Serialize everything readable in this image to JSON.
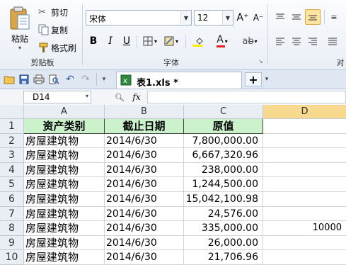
{
  "clipboard": {
    "paste_label": "粘贴",
    "cut_label": "剪切",
    "copy_label": "复制",
    "format_painter_label": "格式刷",
    "group_label": "剪贴板"
  },
  "font": {
    "name": "宋体",
    "size": "12",
    "bold": "B",
    "italic": "I",
    "underline": "U",
    "grow": "A⁺",
    "shrink": "A⁻",
    "group_label": "字体",
    "font_color": "#e02020",
    "highlight_color": "#ffee00"
  },
  "align": {
    "group_label_partial": "对"
  },
  "tabbar": {
    "file_tab": "表1.xls *",
    "add_tab": "+"
  },
  "formula_bar": {
    "name_box": "D14",
    "fx": "fx"
  },
  "sheet": {
    "columns": [
      "A",
      "B",
      "C",
      "D"
    ],
    "selected_column": "D",
    "header_row": [
      "资产类别",
      "截止日期",
      "原值"
    ],
    "header_fill": "#ccf2cc",
    "rows": [
      {
        "num": "1",
        "a": "资产类别",
        "b": "截止日期",
        "c": "原值",
        "d": ""
      },
      {
        "num": "2",
        "a": "房屋建筑物",
        "b": "2014/6/30",
        "c": "7,800,000.00",
        "d": ""
      },
      {
        "num": "3",
        "a": "房屋建筑物",
        "b": "2014/6/30",
        "c": "6,667,320.96",
        "d": ""
      },
      {
        "num": "4",
        "a": "房屋建筑物",
        "b": "2014/6/30",
        "c": "238,000.00",
        "d": ""
      },
      {
        "num": "5",
        "a": "房屋建筑物",
        "b": "2014/6/30",
        "c": "1,244,500.00",
        "d": ""
      },
      {
        "num": "6",
        "a": "房屋建筑物",
        "b": "2014/6/30",
        "c": "15,042,100.98",
        "d": ""
      },
      {
        "num": "7",
        "a": "房屋建筑物",
        "b": "2014/6/30",
        "c": "24,576.00",
        "d": ""
      },
      {
        "num": "8",
        "a": "房屋建筑物",
        "b": "2014/6/30",
        "c": "335,000.00",
        "d": "10000"
      },
      {
        "num": "9",
        "a": "房屋建筑物",
        "b": "2014/6/30",
        "c": "26,000.00",
        "d": ""
      },
      {
        "num": "10",
        "a": "房屋建筑物",
        "b": "2014/6/30",
        "c": "21,706.96",
        "d": ""
      }
    ]
  }
}
